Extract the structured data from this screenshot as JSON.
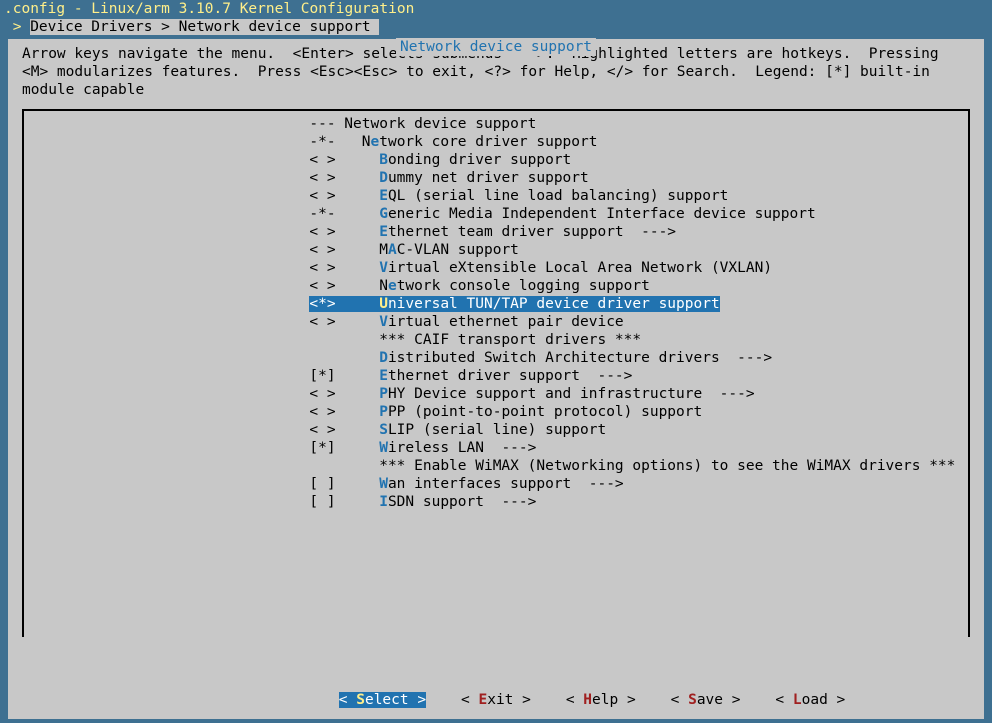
{
  "title": ".config - Linux/arm 3.10.7 Kernel Configuration",
  "breadcrumb": {
    "arrow": " > ",
    "raw": "Device Drivers > Network device support "
  },
  "panel_title": "Network device support",
  "help": "Arrow keys navigate the menu.  <Enter> selects submenus --->.  Highlighted letters are hotkeys.  Pressing <M> modularizes features.  Press <Esc><Esc> to exit, <?> for Help, </> for Search.  Legend: [*] built-in module capable",
  "selected_index": 10,
  "menu": [
    {
      "mk": "---",
      "hot": "",
      "pre": "",
      "txt": "Network device support",
      "post": "",
      "indent": 0
    },
    {
      "mk": "-*-",
      "hot": "e",
      "pre": "N",
      "txt": "twork core driver support",
      "post": "",
      "indent": 1
    },
    {
      "mk": "< >",
      "hot": "B",
      "pre": "",
      "txt": "onding driver support",
      "post": "",
      "indent": 2
    },
    {
      "mk": "< >",
      "hot": "D",
      "pre": "",
      "txt": "ummy net driver support",
      "post": "",
      "indent": 2
    },
    {
      "mk": "< >",
      "hot": "E",
      "pre": "",
      "txt": "QL (serial line load balancing) support",
      "post": "",
      "indent": 2
    },
    {
      "mk": "-*-",
      "hot": "G",
      "pre": "",
      "txt": "eneric Media Independent Interface device support",
      "post": "",
      "indent": 2
    },
    {
      "mk": "< >",
      "hot": "E",
      "pre": "",
      "txt": "thernet team driver support  --->",
      "post": "",
      "indent": 2
    },
    {
      "mk": "< >",
      "hot": "A",
      "pre": "M",
      "txt": "C-VLAN support",
      "post": "",
      "indent": 2
    },
    {
      "mk": "< >",
      "hot": "V",
      "pre": "",
      "txt": "irtual eXtensible Local Area Network (VXLAN)",
      "post": "",
      "indent": 2
    },
    {
      "mk": "< >",
      "hot": "e",
      "pre": "N",
      "txt": "twork console logging support",
      "post": "",
      "indent": 2
    },
    {
      "mk": "<*>",
      "hot": "U",
      "pre": "",
      "txt": "niversal TUN/TAP device driver support",
      "post": "",
      "indent": 2
    },
    {
      "mk": "< >",
      "hot": "V",
      "pre": "",
      "txt": "irtual ethernet pair device",
      "post": "",
      "indent": 2
    },
    {
      "mk": "   ",
      "hot": "",
      "pre": "",
      "txt": "*** CAIF transport drivers ***",
      "post": "",
      "indent": 2
    },
    {
      "mk": "   ",
      "hot": "D",
      "pre": "",
      "txt": "istributed Switch Architecture drivers  --->",
      "post": "",
      "indent": 2
    },
    {
      "mk": "[*]",
      "hot": "E",
      "pre": "",
      "txt": "thernet driver support  --->",
      "post": "",
      "indent": 2
    },
    {
      "mk": "< >",
      "hot": "P",
      "pre": "",
      "txt": "HY Device support and infrastructure  --->",
      "post": "",
      "indent": 2
    },
    {
      "mk": "< >",
      "hot": "P",
      "pre": "",
      "txt": "PP (point-to-point protocol) support",
      "post": "",
      "indent": 2
    },
    {
      "mk": "< >",
      "hot": "S",
      "pre": "",
      "txt": "LIP (serial line) support",
      "post": "",
      "indent": 2
    },
    {
      "mk": "[*]",
      "hot": "W",
      "pre": "",
      "txt": "ireless LAN  --->",
      "post": "",
      "indent": 2
    },
    {
      "mk": "   ",
      "hot": "",
      "pre": "",
      "txt": "*** Enable WiMAX (Networking options) to see the WiMAX drivers ***",
      "post": "",
      "indent": 2
    },
    {
      "mk": "[ ]",
      "hot": "W",
      "pre": "",
      "txt": "an interfaces support  --->",
      "post": "",
      "indent": 2
    },
    {
      "mk": "[ ]",
      "hot": "I",
      "pre": "",
      "txt": "SDN support  --->",
      "post": "",
      "indent": 2
    }
  ],
  "buttons": [
    {
      "hot": "S",
      "label": "elect",
      "selected": true
    },
    {
      "hot": "E",
      "label": "xit",
      "selected": false
    },
    {
      "hot": "H",
      "label": "elp",
      "selected": false
    },
    {
      "hot": "S",
      "label": "ave",
      "selected": false
    },
    {
      "hot": "L",
      "label": "oad",
      "selected": false
    }
  ]
}
